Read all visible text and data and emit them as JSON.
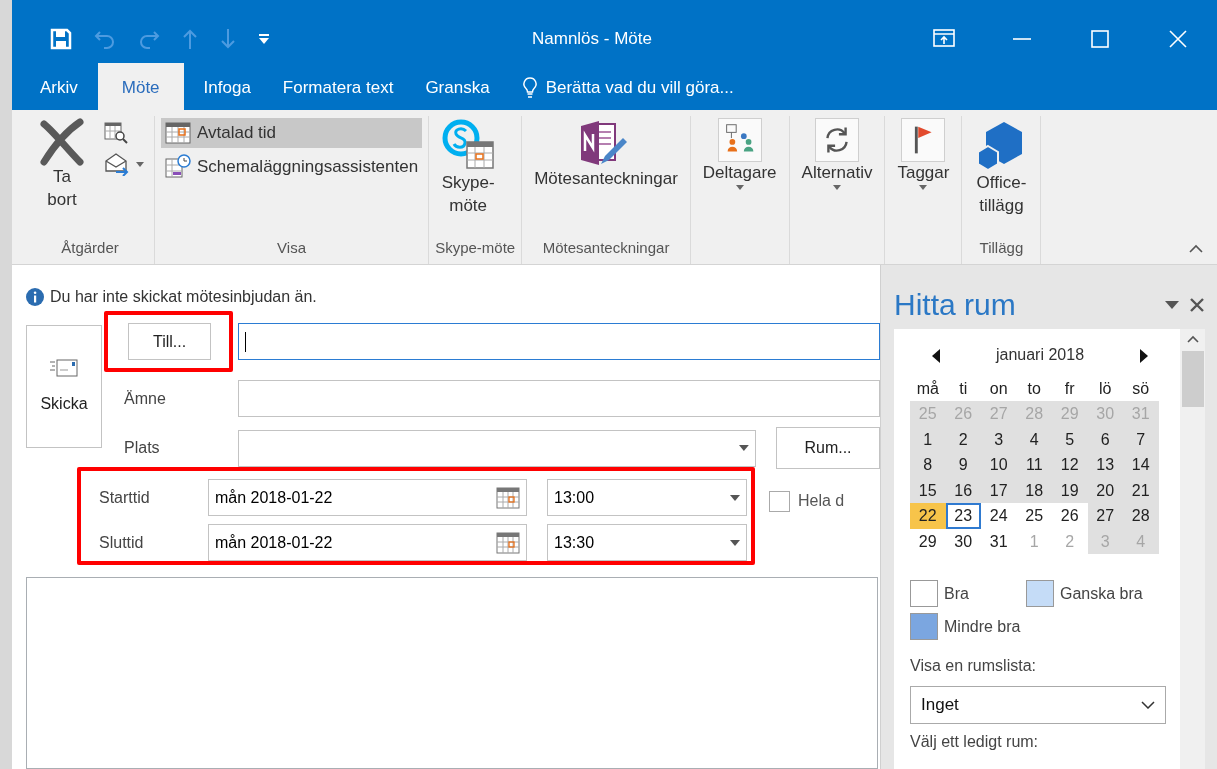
{
  "window": {
    "title": "Namnlös - Möte"
  },
  "quick_access": [
    {
      "disabled": false
    },
    {
      "disabled": true
    },
    {
      "disabled": true
    },
    {
      "disabled": true
    },
    {
      "disabled": true
    },
    {
      "disabled": false
    }
  ],
  "tabs": [
    {
      "label": "Arkiv",
      "selected": false
    },
    {
      "label": "Möte",
      "selected": true
    },
    {
      "label": "Infoga",
      "selected": false
    },
    {
      "label": "Formatera text",
      "selected": false
    },
    {
      "label": "Granska",
      "selected": false
    }
  ],
  "tell_me": {
    "placeholder": "Berätta vad du vill göra..."
  },
  "ribbon": [
    {
      "label": "Åtgärder",
      "items": [
        {
          "kind": "large",
          "label": "Ta bort",
          "dropdown": false
        },
        {
          "kind": "stack",
          "entries": [
            {
              "dropdown": false,
              "selected": false
            },
            {
              "dropdown": true,
              "selected": false
            }
          ]
        }
      ]
    },
    {
      "label": "Visa",
      "items": [
        {
          "kind": "stack",
          "entries": [
            {
              "label": "Avtalad tid",
              "dropdown": false,
              "selected": true
            },
            {
              "label": "Schemaläggningsassistenten",
              "dropdown": false,
              "selected": false
            }
          ]
        }
      ]
    },
    {
      "label": "Skype-möte",
      "items": [
        {
          "kind": "large",
          "label": "Skype-möte",
          "dropdown": false
        }
      ]
    },
    {
      "label": "Mötesanteckningar",
      "items": [
        {
          "kind": "large",
          "label": "Mötesanteckningar",
          "dropdown": false
        }
      ]
    },
    {
      "items": [
        {
          "kind": "large",
          "label": "Deltagare",
          "dropdown": true
        }
      ]
    },
    {
      "items": [
        {
          "kind": "large",
          "label": "Alternativ",
          "dropdown": true
        }
      ]
    },
    {
      "items": [
        {
          "kind": "large",
          "label": "Taggar",
          "dropdown": true
        }
      ]
    },
    {
      "label": "Tillägg",
      "items": [
        {
          "kind": "large",
          "label": "Office-tillägg",
          "dropdown": false
        }
      ]
    }
  ],
  "info": "Du har inte skickat mötesinbjudan än.",
  "send_button": "Skicka",
  "to": {
    "button": "Till...",
    "highlighted": true
  },
  "subject": {
    "label": "Ämne"
  },
  "location": {
    "label": "Plats",
    "room_button": "Rum..."
  },
  "times": {
    "highlighted": true,
    "rows": [
      {
        "label": "Starttid",
        "date": "mån 2018-01-22",
        "time": "13:00"
      },
      {
        "label": "Sluttid",
        "date": "mån 2018-01-22",
        "time": "13:30"
      }
    ]
  },
  "all_day": {
    "label": "Hela d",
    "checked": false
  },
  "pane": {
    "title": "Hitta rum",
    "calendar": {
      "month": "januari 2018",
      "weekdays": [
        "må",
        "ti",
        "on",
        "to",
        "fr",
        "lö",
        "sö"
      ],
      "weeks": [
        [
          {
            "d": "25",
            "muted": true,
            "shaded": true,
            "selected": false,
            "today": false
          },
          {
            "d": "26",
            "muted": true,
            "shaded": true,
            "selected": false,
            "today": false
          },
          {
            "d": "27",
            "muted": true,
            "shaded": true,
            "selected": false,
            "today": false
          },
          {
            "d": "28",
            "muted": true,
            "shaded": true,
            "selected": false,
            "today": false
          },
          {
            "d": "29",
            "muted": true,
            "shaded": true,
            "selected": false,
            "today": false
          },
          {
            "d": "30",
            "muted": true,
            "shaded": true,
            "selected": false,
            "today": false
          },
          {
            "d": "31",
            "muted": true,
            "shaded": true,
            "selected": false,
            "today": false
          }
        ],
        [
          {
            "d": "1",
            "muted": false,
            "shaded": true,
            "selected": false,
            "today": false
          },
          {
            "d": "2",
            "muted": false,
            "shaded": true,
            "selected": false,
            "today": false
          },
          {
            "d": "3",
            "muted": false,
            "shaded": true,
            "selected": false,
            "today": false
          },
          {
            "d": "4",
            "muted": false,
            "shaded": true,
            "selected": false,
            "today": false
          },
          {
            "d": "5",
            "muted": false,
            "shaded": true,
            "selected": false,
            "today": false
          },
          {
            "d": "6",
            "muted": false,
            "shaded": true,
            "selected": false,
            "today": false
          },
          {
            "d": "7",
            "muted": false,
            "shaded": true,
            "selected": false,
            "today": false
          }
        ],
        [
          {
            "d": "8",
            "muted": false,
            "shaded": true,
            "selected": false,
            "today": false
          },
          {
            "d": "9",
            "muted": false,
            "shaded": true,
            "selected": false,
            "today": false
          },
          {
            "d": "10",
            "muted": false,
            "shaded": true,
            "selected": false,
            "today": false
          },
          {
            "d": "11",
            "muted": false,
            "shaded": true,
            "selected": false,
            "today": false
          },
          {
            "d": "12",
            "muted": false,
            "shaded": true,
            "selected": false,
            "today": false
          },
          {
            "d": "13",
            "muted": false,
            "shaded": true,
            "selected": false,
            "today": false
          },
          {
            "d": "14",
            "muted": false,
            "shaded": true,
            "selected": false,
            "today": false
          }
        ],
        [
          {
            "d": "15",
            "muted": false,
            "shaded": true,
            "selected": false,
            "today": false
          },
          {
            "d": "16",
            "muted": false,
            "shaded": true,
            "selected": false,
            "today": false
          },
          {
            "d": "17",
            "muted": false,
            "shaded": true,
            "selected": false,
            "today": false
          },
          {
            "d": "18",
            "muted": false,
            "shaded": true,
            "selected": false,
            "today": false
          },
          {
            "d": "19",
            "muted": false,
            "shaded": true,
            "selected": false,
            "today": false
          },
          {
            "d": "20",
            "muted": false,
            "shaded": true,
            "selected": false,
            "today": false
          },
          {
            "d": "21",
            "muted": false,
            "shaded": true,
            "selected": false,
            "today": false
          }
        ],
        [
          {
            "d": "22",
            "muted": false,
            "shaded": false,
            "selected": true,
            "today": false
          },
          {
            "d": "23",
            "muted": false,
            "shaded": false,
            "selected": false,
            "today": true
          },
          {
            "d": "24",
            "muted": false,
            "shaded": false,
            "selected": false,
            "today": false
          },
          {
            "d": "25",
            "muted": false,
            "shaded": false,
            "selected": false,
            "today": false
          },
          {
            "d": "26",
            "muted": false,
            "shaded": false,
            "selected": false,
            "today": false
          },
          {
            "d": "27",
            "muted": false,
            "shaded": true,
            "selected": false,
            "today": false
          },
          {
            "d": "28",
            "muted": false,
            "shaded": true,
            "selected": false,
            "today": false
          }
        ],
        [
          {
            "d": "29",
            "muted": false,
            "shaded": false,
            "selected": false,
            "today": false
          },
          {
            "d": "30",
            "muted": false,
            "shaded": false,
            "selected": false,
            "today": false
          },
          {
            "d": "31",
            "muted": false,
            "shaded": false,
            "selected": false,
            "today": false
          },
          {
            "d": "1",
            "muted": true,
            "shaded": false,
            "selected": false,
            "today": false
          },
          {
            "d": "2",
            "muted": true,
            "shaded": false,
            "selected": false,
            "today": false
          },
          {
            "d": "3",
            "muted": true,
            "shaded": true,
            "selected": false,
            "today": false
          },
          {
            "d": "4",
            "muted": true,
            "shaded": true,
            "selected": false,
            "today": false
          }
        ]
      ]
    },
    "legend": [
      {
        "label": "Bra",
        "color": "#ffffff"
      },
      {
        "label": "Ganska bra",
        "color": "#c5dcf7"
      },
      {
        "label": "Mindre bra",
        "color": "#7ba6e0"
      }
    ],
    "room_list_label": "Visa en rumslista:",
    "room_list": {
      "value": "Inget"
    },
    "free_room_label": "Välj ett ledigt rum:"
  }
}
